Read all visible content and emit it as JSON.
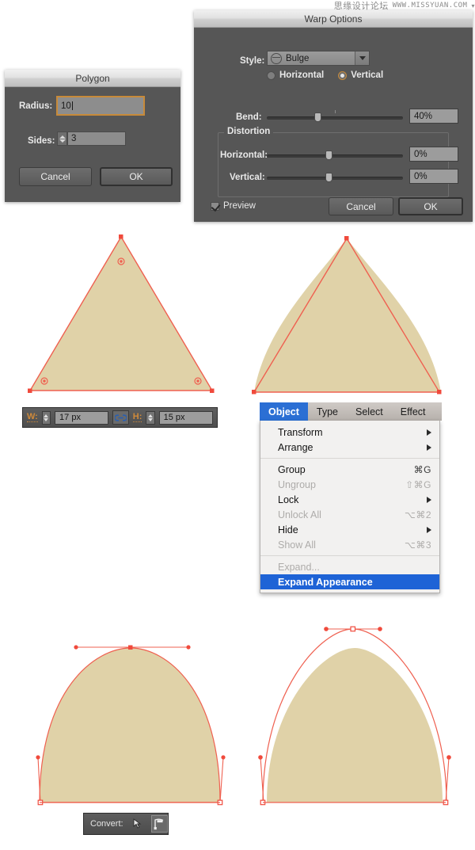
{
  "watermark": {
    "cn": "思缘设计论坛",
    "url": "WWW.MISSYUAN.COM"
  },
  "polygon_dialog": {
    "title": "Polygon",
    "radius_label": "Radius:",
    "radius_value": "10",
    "sides_label": "Sides:",
    "sides_value": "3",
    "cancel_label": "Cancel",
    "ok_label": "OK"
  },
  "warp_dialog": {
    "title": "Warp Options",
    "style_label": "Style:",
    "style_value": "Bulge",
    "style_icon": "bulge-icon",
    "orientation": {
      "horizontal_label": "Horizontal",
      "vertical_label": "Vertical",
      "selected": "Vertical"
    },
    "bend_label": "Bend:",
    "bend_value": "40%",
    "distortion_legend": "Distortion",
    "distortion_horizontal_label": "Horizontal:",
    "distortion_horizontal_value": "0%",
    "distortion_vertical_label": "Vertical:",
    "distortion_vertical_value": "0%",
    "preview_label": "Preview",
    "preview_checked": true,
    "cancel_label": "Cancel",
    "ok_label": "OK"
  },
  "wh_toolbar": {
    "width_key": "W:",
    "width_value": "17 px",
    "link_icon": "chain-link-icon",
    "height_key": "H:",
    "height_value": "15 px"
  },
  "menubar": {
    "items": [
      {
        "label": "Object",
        "active": true
      },
      {
        "label": "Type",
        "active": false
      },
      {
        "label": "Select",
        "active": false
      },
      {
        "label": "Effect",
        "active": false
      }
    ]
  },
  "object_menu": {
    "items": [
      {
        "label": "Transform",
        "shortcut": "",
        "submenu": true,
        "disabled": false,
        "selected": false
      },
      {
        "label": "Arrange",
        "shortcut": "",
        "submenu": true,
        "disabled": false,
        "selected": false
      },
      {
        "separator": true
      },
      {
        "label": "Group",
        "shortcut": "⌘G",
        "submenu": false,
        "disabled": false,
        "selected": false
      },
      {
        "label": "Ungroup",
        "shortcut": "⇧⌘G",
        "submenu": false,
        "disabled": true,
        "selected": false
      },
      {
        "label": "Lock",
        "shortcut": "",
        "submenu": true,
        "disabled": false,
        "selected": false
      },
      {
        "label": "Unlock All",
        "shortcut": "⌥⌘2",
        "submenu": false,
        "disabled": true,
        "selected": false
      },
      {
        "label": "Hide",
        "shortcut": "",
        "submenu": true,
        "disabled": false,
        "selected": false
      },
      {
        "label": "Show All",
        "shortcut": "⌥⌘3",
        "submenu": false,
        "disabled": true,
        "selected": false
      },
      {
        "separator": true
      },
      {
        "label": "Expand...",
        "shortcut": "",
        "submenu": false,
        "disabled": true,
        "selected": false
      },
      {
        "label": "Expand Appearance",
        "shortcut": "",
        "submenu": false,
        "disabled": false,
        "selected": true
      }
    ]
  },
  "convert_toolbar": {
    "label": "Convert:",
    "buttons": [
      {
        "name": "convert-to-smooth-icon",
        "active": false
      },
      {
        "name": "convert-to-corner-icon",
        "active": true
      }
    ]
  },
  "artwork": {
    "fill_color": "#e0d2a8",
    "stroke_color": "#ef6050",
    "anchor_color": "#f04a3c",
    "shapes": [
      {
        "name": "triangle-with-corner-widgets",
        "caption": ""
      },
      {
        "name": "bulge-warped-triangle",
        "caption": ""
      },
      {
        "name": "dome-shape-smooth-apex",
        "caption": ""
      },
      {
        "name": "dome-shape-corner-apex",
        "caption": ""
      }
    ]
  }
}
